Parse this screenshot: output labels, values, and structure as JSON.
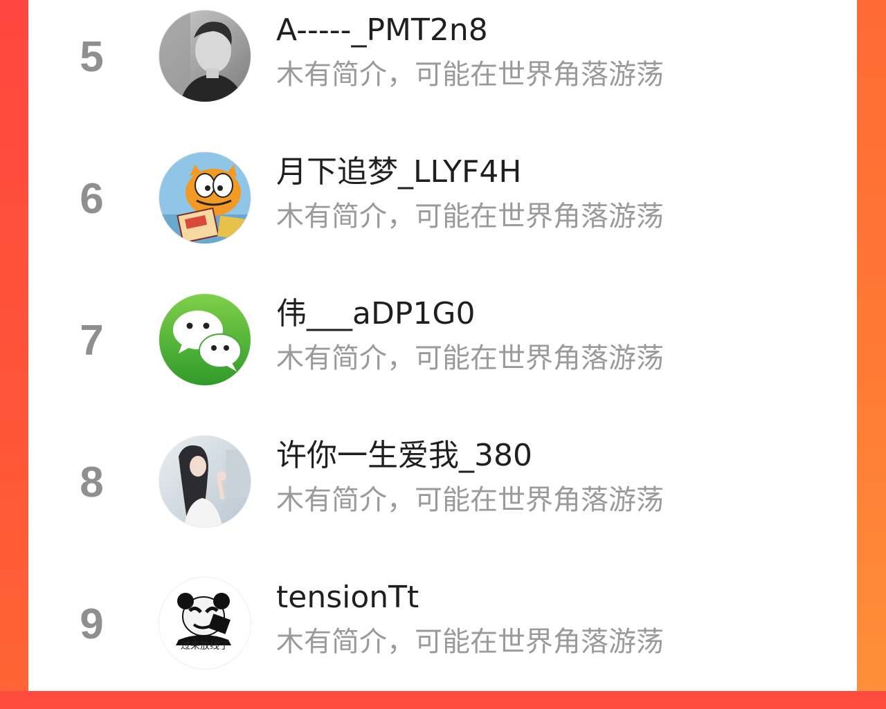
{
  "colors": {
    "panel_background": "#ffffff",
    "side_gradient_left": "#ff4b3e",
    "side_gradient_right": "#ff7d36",
    "rank_text": "#8f8f8f",
    "name_text": "#1f1f1f",
    "bio_text": "#9a9a9a"
  },
  "leaderboard": {
    "entries": [
      {
        "rank": "5",
        "name": "A-----_PMT2n8",
        "bio": "木有简介，可能在世界角落游荡",
        "avatar": "grayscale-man-photo"
      },
      {
        "rank": "6",
        "name": "月下追梦_LLYF4H",
        "bio": "木有简介，可能在世界角落游荡",
        "avatar": "garfield-cartoon"
      },
      {
        "rank": "7",
        "name": "伟___aDP1G0",
        "bio": "木有简介，可能在世界角落游荡",
        "avatar": "wechat-logo"
      },
      {
        "rank": "8",
        "name": "许你一生爱我_380",
        "bio": "木有简介，可能在世界角落游荡",
        "avatar": "girl-photo"
      },
      {
        "rank": "9",
        "name": "tensionTt",
        "bio": "木有简介，可能在世界角落游荡",
        "avatar": "panda-meme",
        "avatar_caption": "过来放线了"
      }
    ]
  }
}
